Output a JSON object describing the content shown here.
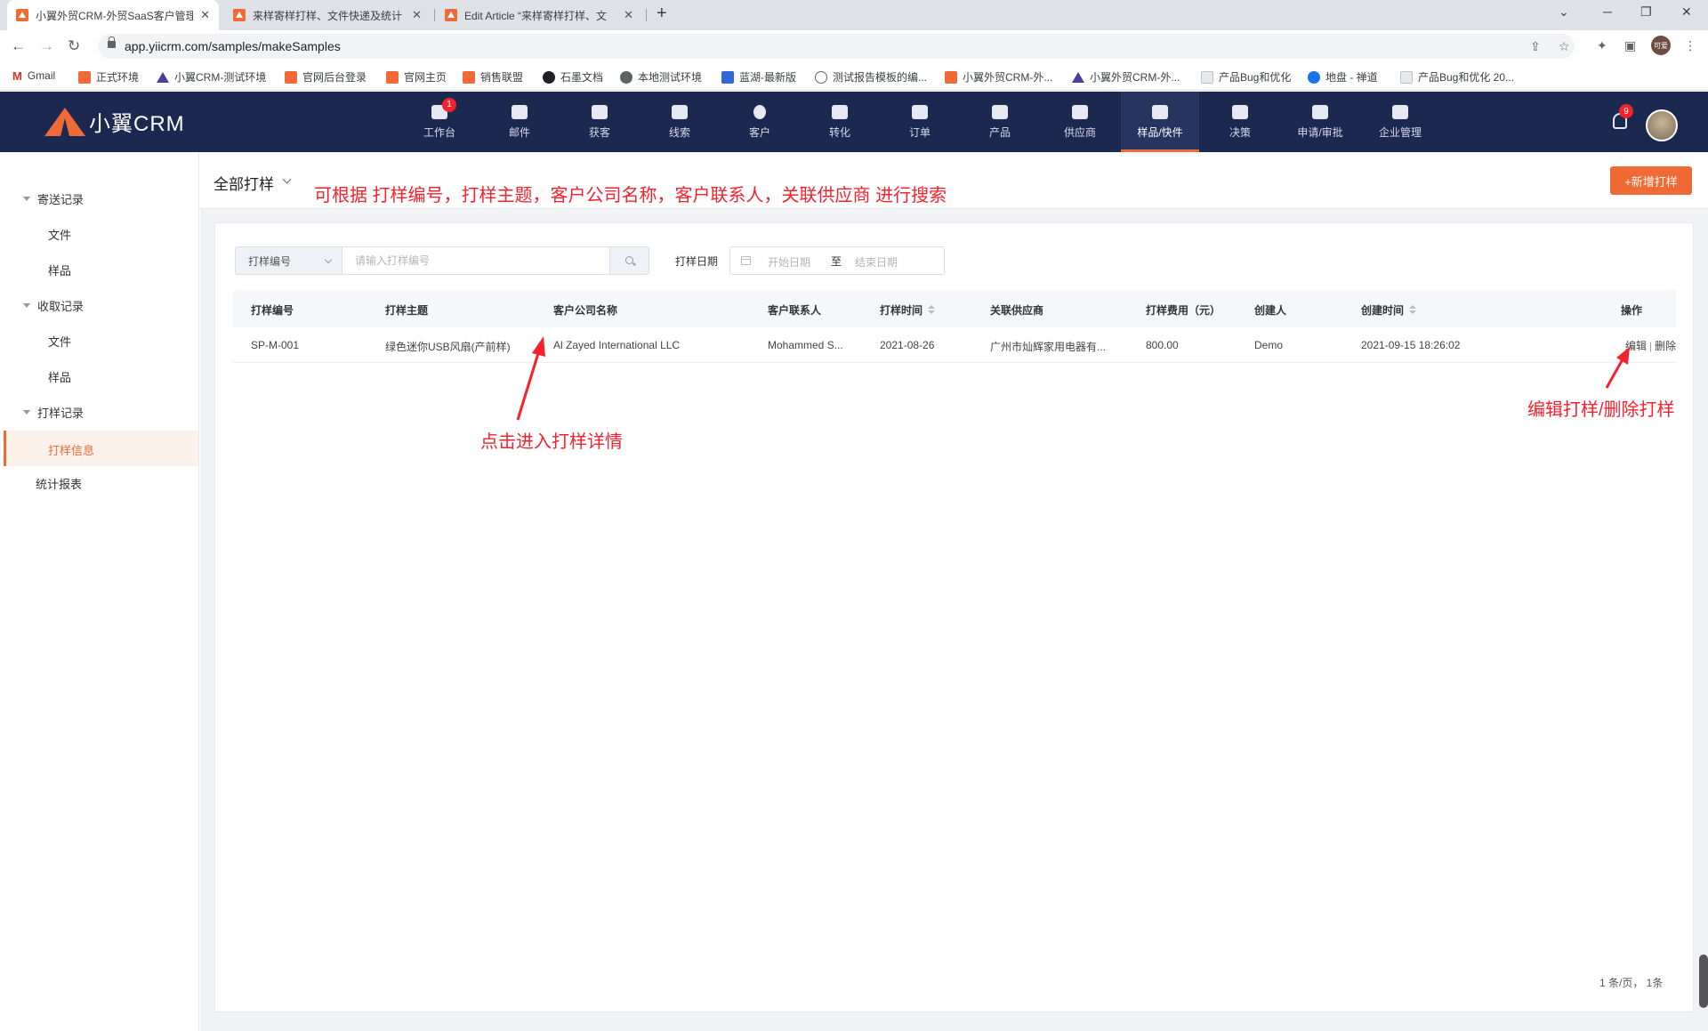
{
  "browser": {
    "tabs": [
      {
        "title": "小翼外贸CRM-外贸SaaS客户管理",
        "active": true
      },
      {
        "title": "来样寄样打样、文件快递及统计",
        "active": false
      },
      {
        "title": "Edit Article “来样寄样打样、文",
        "active": false
      }
    ],
    "url": "app.yiicrm.com/samples/makeSamples",
    "profile_label": "可爱",
    "bookmarks": [
      "Gmail",
      "正式环境",
      "小翼CRM-测试环境",
      "官网后台登录",
      "官网主页",
      "销售联盟",
      "石墨文档",
      "本地测试环境",
      "蓝湖-最新版",
      "测试报告模板的编...",
      "小翼外贸CRM-外...",
      "小翼外贸CRM-外...",
      "产品Bug和优化",
      "地盘 - 禅道",
      "产品Bug和优化 20..."
    ]
  },
  "app": {
    "logo_text": "小翼CRM",
    "nav": [
      {
        "label": "工作台",
        "badge": "1"
      },
      {
        "label": "邮件"
      },
      {
        "label": "获客"
      },
      {
        "label": "线索"
      },
      {
        "label": "客户"
      },
      {
        "label": "转化"
      },
      {
        "label": "订单"
      },
      {
        "label": "产品"
      },
      {
        "label": "供应商"
      },
      {
        "label": "样品/快件",
        "active": true
      },
      {
        "label": "决策"
      },
      {
        "label": "申请/审批"
      },
      {
        "label": "企业管理"
      }
    ],
    "notification_count": "9"
  },
  "sidebar": {
    "groups": [
      {
        "label": "寄送记录",
        "items": [
          "文件",
          "样品"
        ]
      },
      {
        "label": "收取记录",
        "items": [
          "文件",
          "样品"
        ]
      },
      {
        "label": "打样记录",
        "items": [
          "打样信息"
        ]
      }
    ],
    "active_item": "打样信息",
    "report": "统计报表"
  },
  "page": {
    "title": "全部打样",
    "new_button": "+新增打样"
  },
  "filters": {
    "search_type": "打样编号",
    "search_placeholder": "请输入打样编号",
    "date_label": "打样日期",
    "date_start_placeholder": "开始日期",
    "date_separator": "至",
    "date_end_placeholder": "结束日期"
  },
  "table": {
    "columns": [
      "打样编号",
      "打样主题",
      "客户公司名称",
      "客户联系人",
      "打样时间",
      "关联供应商",
      "打样费用（元）",
      "创建人",
      "创建时间",
      "操作"
    ],
    "rows": [
      {
        "id": "SP-M-001",
        "subject": "绿色迷你USB风扇(产前样)",
        "company": "Al Zayed International LLC",
        "contact": "Mohammed S...",
        "date": "2021-08-26",
        "supplier": "广州市灿辉家用电器有...",
        "cost": "800.00",
        "creator": "Demo",
        "created_at": "2021-09-15 18:26:02",
        "edit": "编辑",
        "op_sep": "|",
        "delete": "删除"
      }
    ]
  },
  "pagination": {
    "text": "1 条/页，  1条"
  },
  "annotations": {
    "top": "可根据 打样编号，打样主题，客户公司名称，客户联系人，关联供应商 进行搜索",
    "detail": "点击进入打样详情",
    "ops": "编辑打样/删除打样"
  }
}
